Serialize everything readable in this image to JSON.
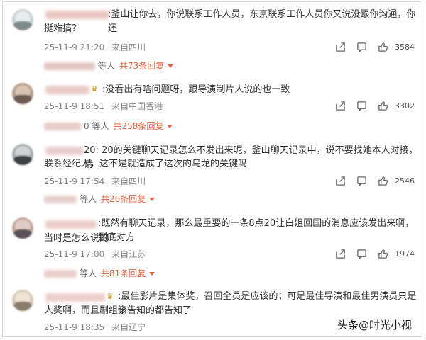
{
  "comments": [
    {
      "text_line1": ":釜山让你去，你说联系工作人员，东京联系工作人员你又说没跟你沟通，你还",
      "text_line2": "挺难搞?",
      "date": "25-11-9 21:20",
      "location": "来自四川",
      "likes": "3584",
      "reply_suffix": "等人",
      "reply_count": "共73条回复",
      "avatar_colors": [
        "#c9d1d3",
        "#7f8a8e"
      ]
    },
    {
      "text_line1": ":没看出有啥问题呀，跟导演制片人说的也一致",
      "text_line2": "",
      "date": "25-11-9 18:51",
      "location": "来自中国香港",
      "likes": "3302",
      "reply_prefix": "0",
      "reply_suffix": "等人",
      "reply_count": "共258条回复",
      "avatar_colors": [
        "#b69a86",
        "#6e5c52"
      ]
    },
    {
      "text_line1": "20:  20的关键聊天记录怎么不发出来呢，釜山聊天记录中，说不要找她本人对接，请",
      "text_line2": "联系经纪人，这不是就造成了这次的乌龙的关键吗",
      "date": "25-11-9 17:54",
      "location": "来自四川",
      "likes": "2546",
      "reply_suffix": "等人",
      "reply_count": "共26条回复",
      "avatar_colors": [
        "#a4a8ad",
        "#3d3f44"
      ]
    },
    {
      "text_line1": ":既然有聊天记录，那么最重要的一条8点20让白姐回国的消息应该发出来啊，到底对方",
      "text_line2": "当时是怎么说的",
      "date": "25-11-9 17:00",
      "location": "来自江苏",
      "likes": "1974",
      "reply_suffix": "等人",
      "reply_count": "共81条回复",
      "avatar_colors": [
        "#c6a79e",
        "#5b5058"
      ]
    },
    {
      "text_line1": ":最佳影片是集体奖，召回全员是应该的；可是最佳导演和最佳男演员只是个",
      "text_line2": "人奖啊，而且剧组该告知的都告知了",
      "date": "25-11-9 18:35",
      "location": "来自辽宁",
      "avatar_colors": [
        "#d7c8b6",
        "#8b7d6e"
      ]
    }
  ],
  "watermark": {
    "prefix": "头条",
    "at": "@",
    "name": "时光小视"
  },
  "icons": {
    "share": "share-icon",
    "comment": "comment-icon",
    "like": "thumbs-up-icon",
    "crown": "crown-badge-icon"
  },
  "colors": {
    "reply_count": "#e8603c",
    "meta": "#888888"
  }
}
